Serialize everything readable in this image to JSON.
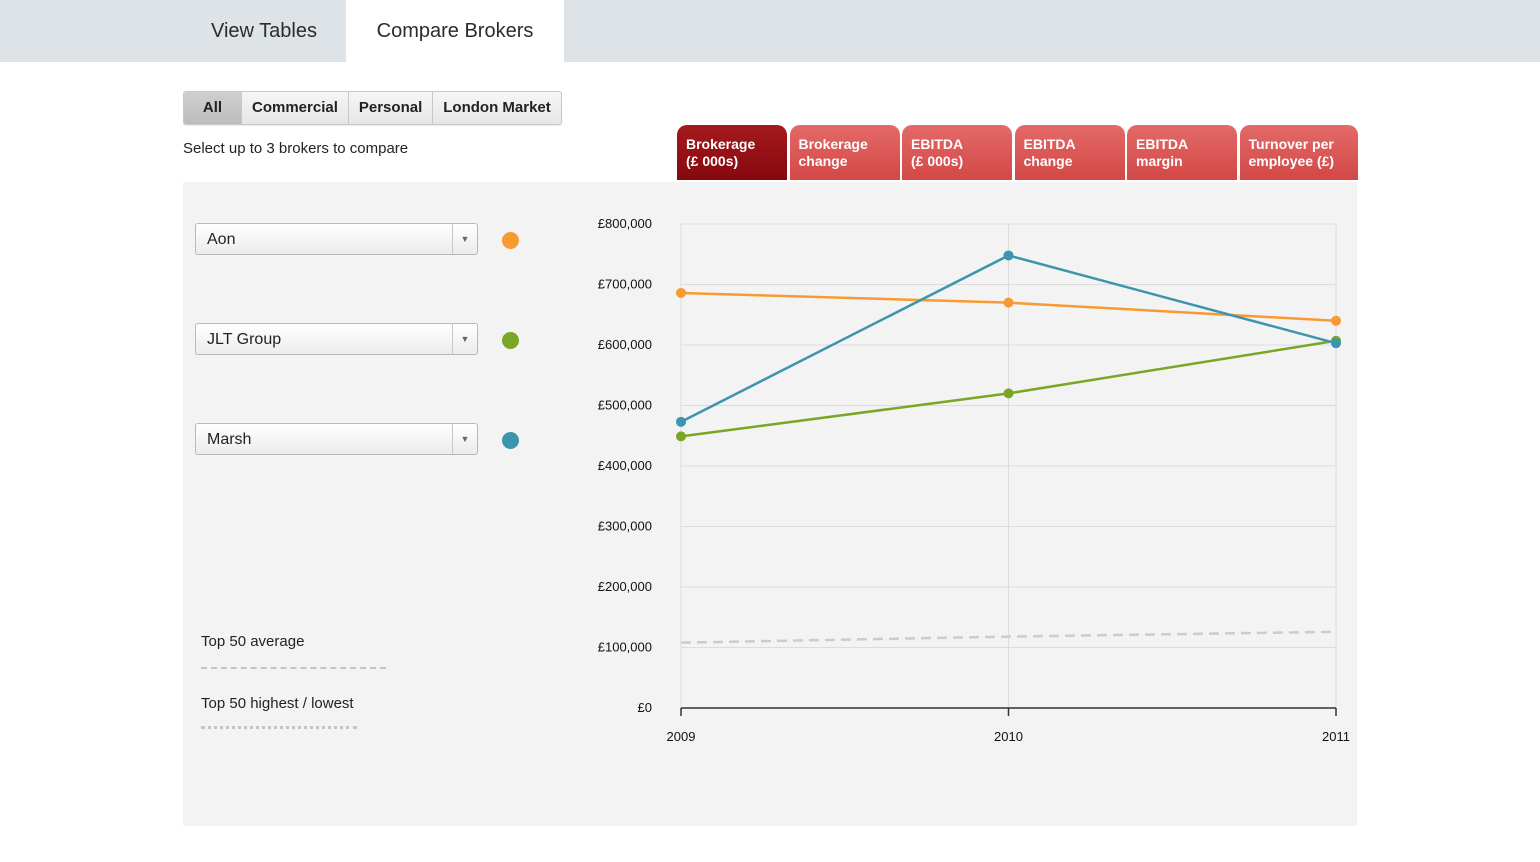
{
  "top_tabs": [
    {
      "label": "View Tables"
    },
    {
      "label": "Compare Brokers"
    }
  ],
  "filters": [
    "All",
    "Commercial",
    "Personal",
    "London Market"
  ],
  "instruction": "Select up to 3 brokers to compare",
  "metric_tabs": [
    {
      "line1": "Brokerage",
      "line2": "(£ 000s)"
    },
    {
      "line1": "Brokerage",
      "line2": "change"
    },
    {
      "line1": "EBITDA",
      "line2": "(£ 000s)"
    },
    {
      "line1": "EBITDA",
      "line2": "change"
    },
    {
      "line1": "EBITDA",
      "line2": "margin"
    },
    {
      "line1": "Turnover per",
      "line2": "employee (£)"
    }
  ],
  "brokers": [
    {
      "name": "Aon",
      "color": "#f79a33"
    },
    {
      "name": "JLT Group",
      "color": "#79a624"
    },
    {
      "name": "Marsh",
      "color": "#3d95ad"
    }
  ],
  "legend": {
    "average": "Top 50 average",
    "high_low": "Top 50 highest / lowest"
  },
  "chart_data": {
    "type": "line",
    "x": [
      "2009",
      "2010",
      "2011"
    ],
    "ylim": [
      0,
      800000
    ],
    "yticks": [
      "£0",
      "£100,000",
      "£200,000",
      "£300,000",
      "£400,000",
      "£500,000",
      "£600,000",
      "£700,000",
      "£800,000"
    ],
    "grid": true,
    "series": [
      {
        "name": "Aon",
        "color": "#f79a33",
        "values": [
          686000,
          670000,
          640000
        ]
      },
      {
        "name": "JLT Group",
        "color": "#79a624",
        "values": [
          449000,
          520000,
          607000
        ]
      },
      {
        "name": "Marsh",
        "color": "#3d95ad",
        "values": [
          473000,
          748000,
          603000
        ]
      },
      {
        "name": "Top 50 average",
        "color": "#cccccc",
        "dashed": true,
        "values": [
          108000,
          118000,
          126000
        ]
      }
    ]
  }
}
